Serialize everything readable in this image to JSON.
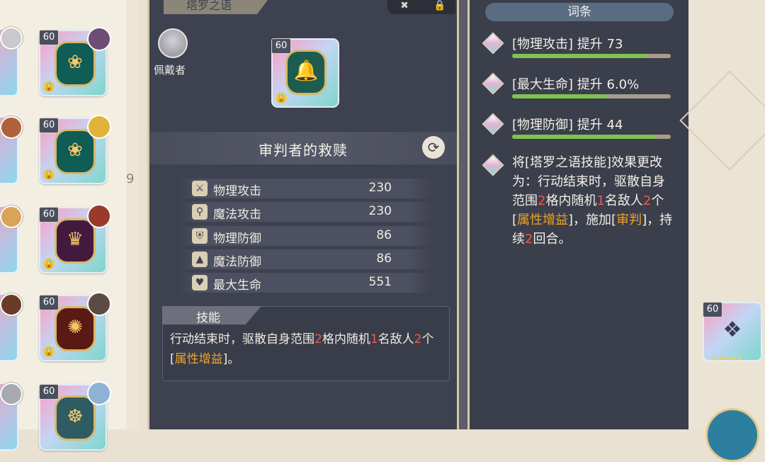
{
  "colors": {
    "panel_bg": "#3e4150",
    "accent_gold": "#d4c8a7",
    "bar_fill": "#7fc24f",
    "number_red": "#ef5a4b",
    "keyword_orange": "#f0a227"
  },
  "inventory": {
    "cards": [
      {
        "level": "60",
        "emblem": "heart-seal-icon",
        "locked": true
      },
      {
        "level": "60",
        "emblem": "heart-seal-icon",
        "locked": true
      },
      {
        "level": "60",
        "emblem": "crown-icon",
        "locked": true
      },
      {
        "level": "60",
        "emblem": "sun-medallion-icon",
        "locked": true
      },
      {
        "level": "60",
        "emblem": "wheel-icon",
        "locked": false
      }
    ],
    "partial_text": "9"
  },
  "center": {
    "tab_title": "塔罗之语",
    "wearer_label": "佩戴者",
    "card_level": "60",
    "item_title": "审判者的救赎",
    "stats": [
      {
        "icon": "sword-icon",
        "name": "物理攻击",
        "value": "230"
      },
      {
        "icon": "staff-icon",
        "name": "魔法攻击",
        "value": "230"
      },
      {
        "icon": "shield-icon",
        "name": "物理防御",
        "value": "86"
      },
      {
        "icon": "wizard-hat-icon",
        "name": "魔法防御",
        "value": "86"
      },
      {
        "icon": "heart-icon",
        "name": "最大生命",
        "value": "551"
      }
    ],
    "skill": {
      "header": "技能",
      "text_parts": [
        {
          "t": "行动结束时，驱散自身范围",
          "c": "plain"
        },
        {
          "t": "2",
          "c": "num"
        },
        {
          "t": "格内随机",
          "c": "plain"
        },
        {
          "t": "1",
          "c": "num"
        },
        {
          "t": "名敌人",
          "c": "plain"
        },
        {
          "t": "2",
          "c": "num"
        },
        {
          "t": "个[",
          "c": "plain"
        },
        {
          "t": "属性增益",
          "c": "kw"
        },
        {
          "t": "]。",
          "c": "plain"
        }
      ]
    }
  },
  "right": {
    "header": "词条",
    "affixes": [
      {
        "label": "[物理攻击] 提升 73",
        "progress": 0.85
      },
      {
        "label": "[最大生命] 提升 6.0%",
        "progress": 0.6
      },
      {
        "label": "[物理防御] 提升 44",
        "progress": 0.9
      }
    ],
    "special_parts": [
      {
        "t": "将[塔罗之语技能]效果更改为：行动结束时，驱散自身范围",
        "c": "plain"
      },
      {
        "t": "2",
        "c": "num"
      },
      {
        "t": "格内随机",
        "c": "plain"
      },
      {
        "t": "1",
        "c": "num"
      },
      {
        "t": "名敌人",
        "c": "plain"
      },
      {
        "t": "2",
        "c": "num"
      },
      {
        "t": "个[",
        "c": "plain"
      },
      {
        "t": "属性增益",
        "c": "kw"
      },
      {
        "t": "]，施加[",
        "c": "plain"
      },
      {
        "t": "审判",
        "c": "kw"
      },
      {
        "t": "]，持续",
        "c": "plain"
      },
      {
        "t": "2",
        "c": "num"
      },
      {
        "t": "回合。",
        "c": "plain"
      }
    ]
  },
  "side_card": {
    "level": "60"
  }
}
